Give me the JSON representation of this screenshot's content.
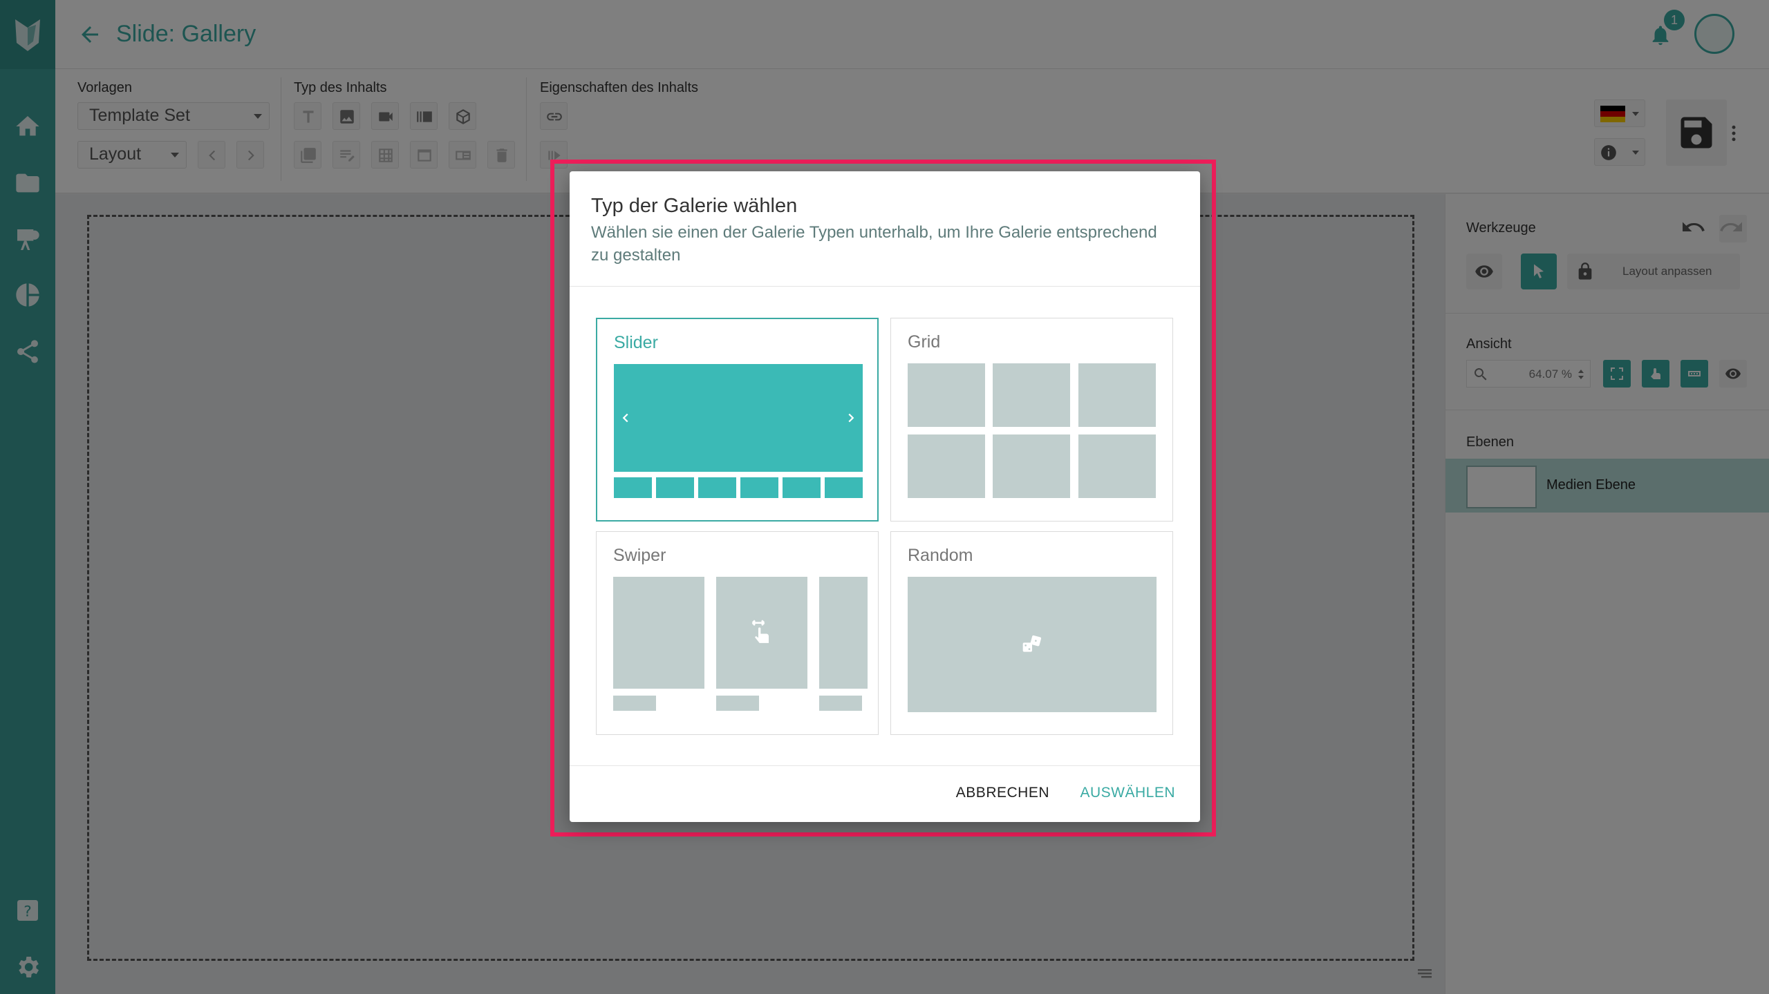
{
  "app": {
    "title": "Slide: Gallery",
    "notification_count": "1"
  },
  "sidebar": {
    "items": [
      "home-icon",
      "folder-icon",
      "presentation-icon",
      "pie-chart-icon",
      "share-icon"
    ],
    "bottom": [
      "help-icon",
      "settings-icon"
    ]
  },
  "toolbar": {
    "vorlagen_label": "Vorlagen",
    "template_select": "Template Set",
    "layout_select": "Layout",
    "content_type_label": "Typ des Inhalts",
    "properties_label": "Eigenschaften des Inhalts"
  },
  "right_panel": {
    "tools_label": "Werkzeuge",
    "layout_button": "Layout anpassen",
    "view_label": "Ansicht",
    "zoom_value": "64.07 %",
    "layers_label": "Ebenen",
    "layer_name": "Medien Ebene"
  },
  "dialog": {
    "title": "Typ der Galerie wählen",
    "subtitle": "Wählen sie einen der Galerie Typen unterhalb, um Ihre Galerie entsprechend zu gestalten",
    "options": [
      {
        "label": "Slider",
        "selected": true
      },
      {
        "label": "Grid",
        "selected": false
      },
      {
        "label": "Swiper",
        "selected": false
      },
      {
        "label": "Random",
        "selected": false
      }
    ],
    "cancel_label": "ABBRECHEN",
    "ok_label": "AUSWÄHLEN"
  },
  "colors": {
    "accent": "#3aaaa3",
    "sidebar": "#3d9e98",
    "highlight": "#ee1e5a",
    "placeholder": "#c0cecd"
  }
}
